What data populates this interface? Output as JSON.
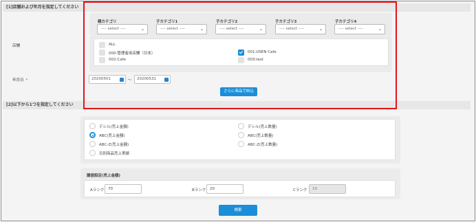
{
  "section1": {
    "title": "[1]店舗および年月を指定してください"
  },
  "store_label": "店舗",
  "yearmonth_label": "年月日",
  "required_mark": "*",
  "categories": [
    {
      "label": "親カテゴリ",
      "value": "---- select ----"
    },
    {
      "label": "子カテゴリ1",
      "value": "---- select ----"
    },
    {
      "label": "子カテゴリ2",
      "value": "---- select ----"
    },
    {
      "label": "子カテゴリ3",
      "value": "---- select ----"
    },
    {
      "label": "子カテゴリ4",
      "value": "---- select ----"
    }
  ],
  "stores": [
    {
      "label": "ALL",
      "checked": false
    },
    {
      "label": "000:管理者用店舗（日本）",
      "checked": false
    },
    {
      "label": "001:USEN Cafe",
      "checked": true
    },
    {
      "label": "002:Cafe",
      "checked": false
    },
    {
      "label": "003:test",
      "checked": false
    }
  ],
  "date_from": "20200501",
  "date_sep": "〜",
  "date_to": "20200531",
  "filter_button": "さらに商品で絞込",
  "section2": {
    "title": "[2]以下から1つを指定してください"
  },
  "options": [
    {
      "label": "デシル(売上金額)",
      "selected": false
    },
    {
      "label": "デシル(売上数量)",
      "selected": false
    },
    {
      "label": "ABC(売上金額)",
      "selected": true
    },
    {
      "label": "ABC(売上数量)",
      "selected": false
    },
    {
      "label": "ABC-Z(売上金額)",
      "selected": false
    },
    {
      "label": "ABC-Z(売上数量)",
      "selected": false
    },
    {
      "label": "日別商品売上実績",
      "selected": false
    }
  ],
  "threshold": {
    "title": "閾値設定(売上金額)",
    "a_label": "Aランク",
    "a_value": "70",
    "b_label": "Bランク",
    "b_value": "20",
    "c_label": "Cランク",
    "c_value": "10"
  },
  "search_button": "検索",
  "colors": {
    "accent": "#1a8ed8",
    "highlight": "#e2121a",
    "panel": "#ebebeb"
  }
}
